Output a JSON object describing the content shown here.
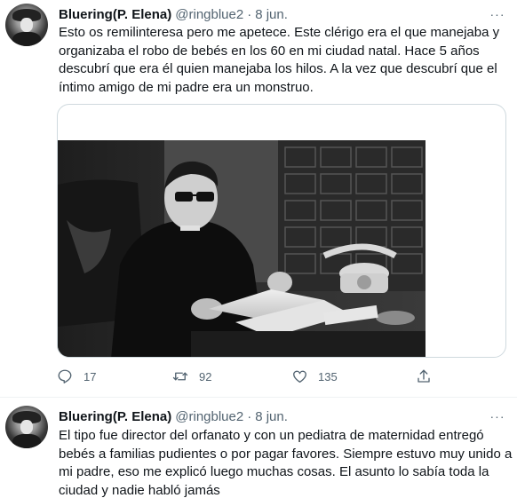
{
  "tweets": [
    {
      "author_name": "Bluering(P. Elena)",
      "handle": "@ringblue2",
      "separator": "·",
      "date": "8 jun.",
      "more_label": "···",
      "text_lines": [
        "Esto os remilinteresa pero me apetece. Este clérigo era el que manejaba y",
        "organizaba el robo de bebés en los 60 en mi ciudad natal. Hace 5 años",
        "descubrí que era él quien manejaba los hilos. A la vez que descubrí que el",
        "íntimo amigo de mi padre era un monstruo."
      ],
      "media": {
        "type": "photo",
        "description_icon": "black-and-white-photo-of-priest-reading-at-desk"
      },
      "actions": {
        "reply_count": "17",
        "retweet_count": "92",
        "like_count": "135"
      }
    },
    {
      "author_name": "Bluering(P. Elena)",
      "handle": "@ringblue2",
      "separator": "·",
      "date": "8 jun.",
      "more_label": "···",
      "text_lines": [
        "El tipo fue director del orfanato y con un pediatra de maternidad entregó",
        "bebés a familias pudientes o por pagar favores. Siempre estuvo muy unido a",
        "mi padre, eso me explicó luego muchas cosas. El asunto lo sabía toda la",
        "ciudad y nadie habló jamás"
      ]
    }
  ],
  "colors": {
    "text_primary": "#0f1419",
    "text_secondary": "#536471",
    "border": "#cfd9de",
    "divider": "#eff3f4"
  }
}
